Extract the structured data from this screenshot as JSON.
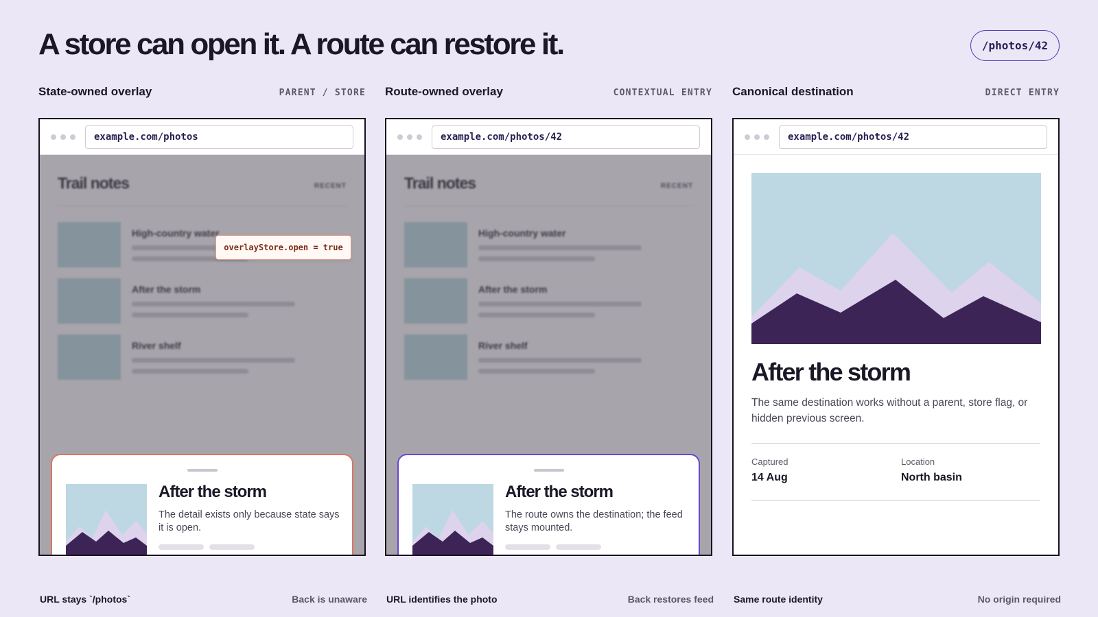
{
  "header": {
    "title": "A store can open it. A route can restore it.",
    "route_pill": "/photos/42"
  },
  "columns": [
    {
      "title": "State-owned overlay",
      "tag": "PARENT / STORE",
      "url": "example.com/photos",
      "feed": {
        "title": "Trail notes",
        "recent": "RECENT",
        "items": [
          "High-country water",
          "After the storm",
          "River shelf"
        ]
      },
      "state_badge": "overlayStore.open = true",
      "sheet": {
        "title": "After the storm",
        "text": "The detail exists only because state says it is open."
      },
      "footer": {
        "left": "URL stays `/photos`",
        "right": "Back is unaware"
      }
    },
    {
      "title": "Route-owned overlay",
      "tag": "CONTEXTUAL ENTRY",
      "url": "example.com/photos/42",
      "feed": {
        "title": "Trail notes",
        "recent": "RECENT",
        "items": [
          "High-country water",
          "After the storm",
          "River shelf"
        ]
      },
      "sheet": {
        "title": "After the storm",
        "text": "The route owns the destination; the feed stays mounted."
      },
      "footer": {
        "left": "URL identifies the photo",
        "right": "Back restores feed"
      }
    },
    {
      "title": "Canonical destination",
      "tag": "DIRECT ENTRY",
      "url": "example.com/photos/42",
      "detail": {
        "title": "After the storm",
        "text": "The same destination works without a parent, store flag, or hidden previous screen.",
        "meta": [
          {
            "label": "Captured",
            "value": "14 Aug"
          },
          {
            "label": "Location",
            "value": "North basin"
          }
        ]
      },
      "footer": {
        "left": "Same route identity",
        "right": "No origin required"
      }
    }
  ],
  "colors": {
    "background": "#ece7f7",
    "accent_purple": "#6a44d4",
    "accent_coral": "#d8775f",
    "mountain_dark": "#3d2456",
    "mountain_light": "#ddd3ec",
    "sky": "#bdd8e3"
  }
}
